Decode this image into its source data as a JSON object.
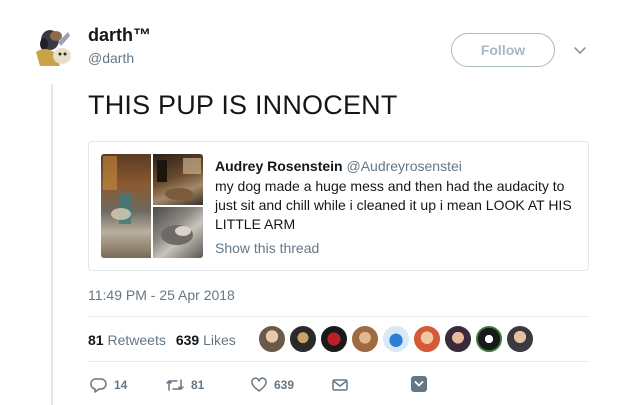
{
  "author": {
    "name": "darth™",
    "handle": "@darth",
    "follow_label": "Follow"
  },
  "tweet": {
    "text": "THIS PUP IS INNOCENT",
    "timestamp": "11:49 PM - 25 Apr 2018"
  },
  "quoted": {
    "name": "Audrey Rosenstein",
    "handle": "@Audreyrosenstei",
    "text": "my dog made a huge mess and then had the audacity to just sit and chill while i cleaned it up i mean LOOK AT HIS LITTLE ARM",
    "thread_link": "Show this thread"
  },
  "stats": {
    "retweets_count": "81",
    "retweets_label": "Retweets",
    "likes_count": "639",
    "likes_label": "Likes"
  },
  "actions": {
    "reply_count": "14",
    "retweet_count": "81",
    "like_count": "639"
  },
  "icons": {
    "menu": "chevron-down-icon",
    "reply": "reply-icon",
    "retweet": "retweet-icon",
    "like": "heart-icon",
    "message": "envelope-icon",
    "bookmark": "bookmark-icon"
  },
  "colors": {
    "text_primary": "#14171a",
    "text_secondary": "#657786",
    "border": "#e1e8ed",
    "follow_border": "#aab8c2",
    "bookmark": "#657786"
  }
}
